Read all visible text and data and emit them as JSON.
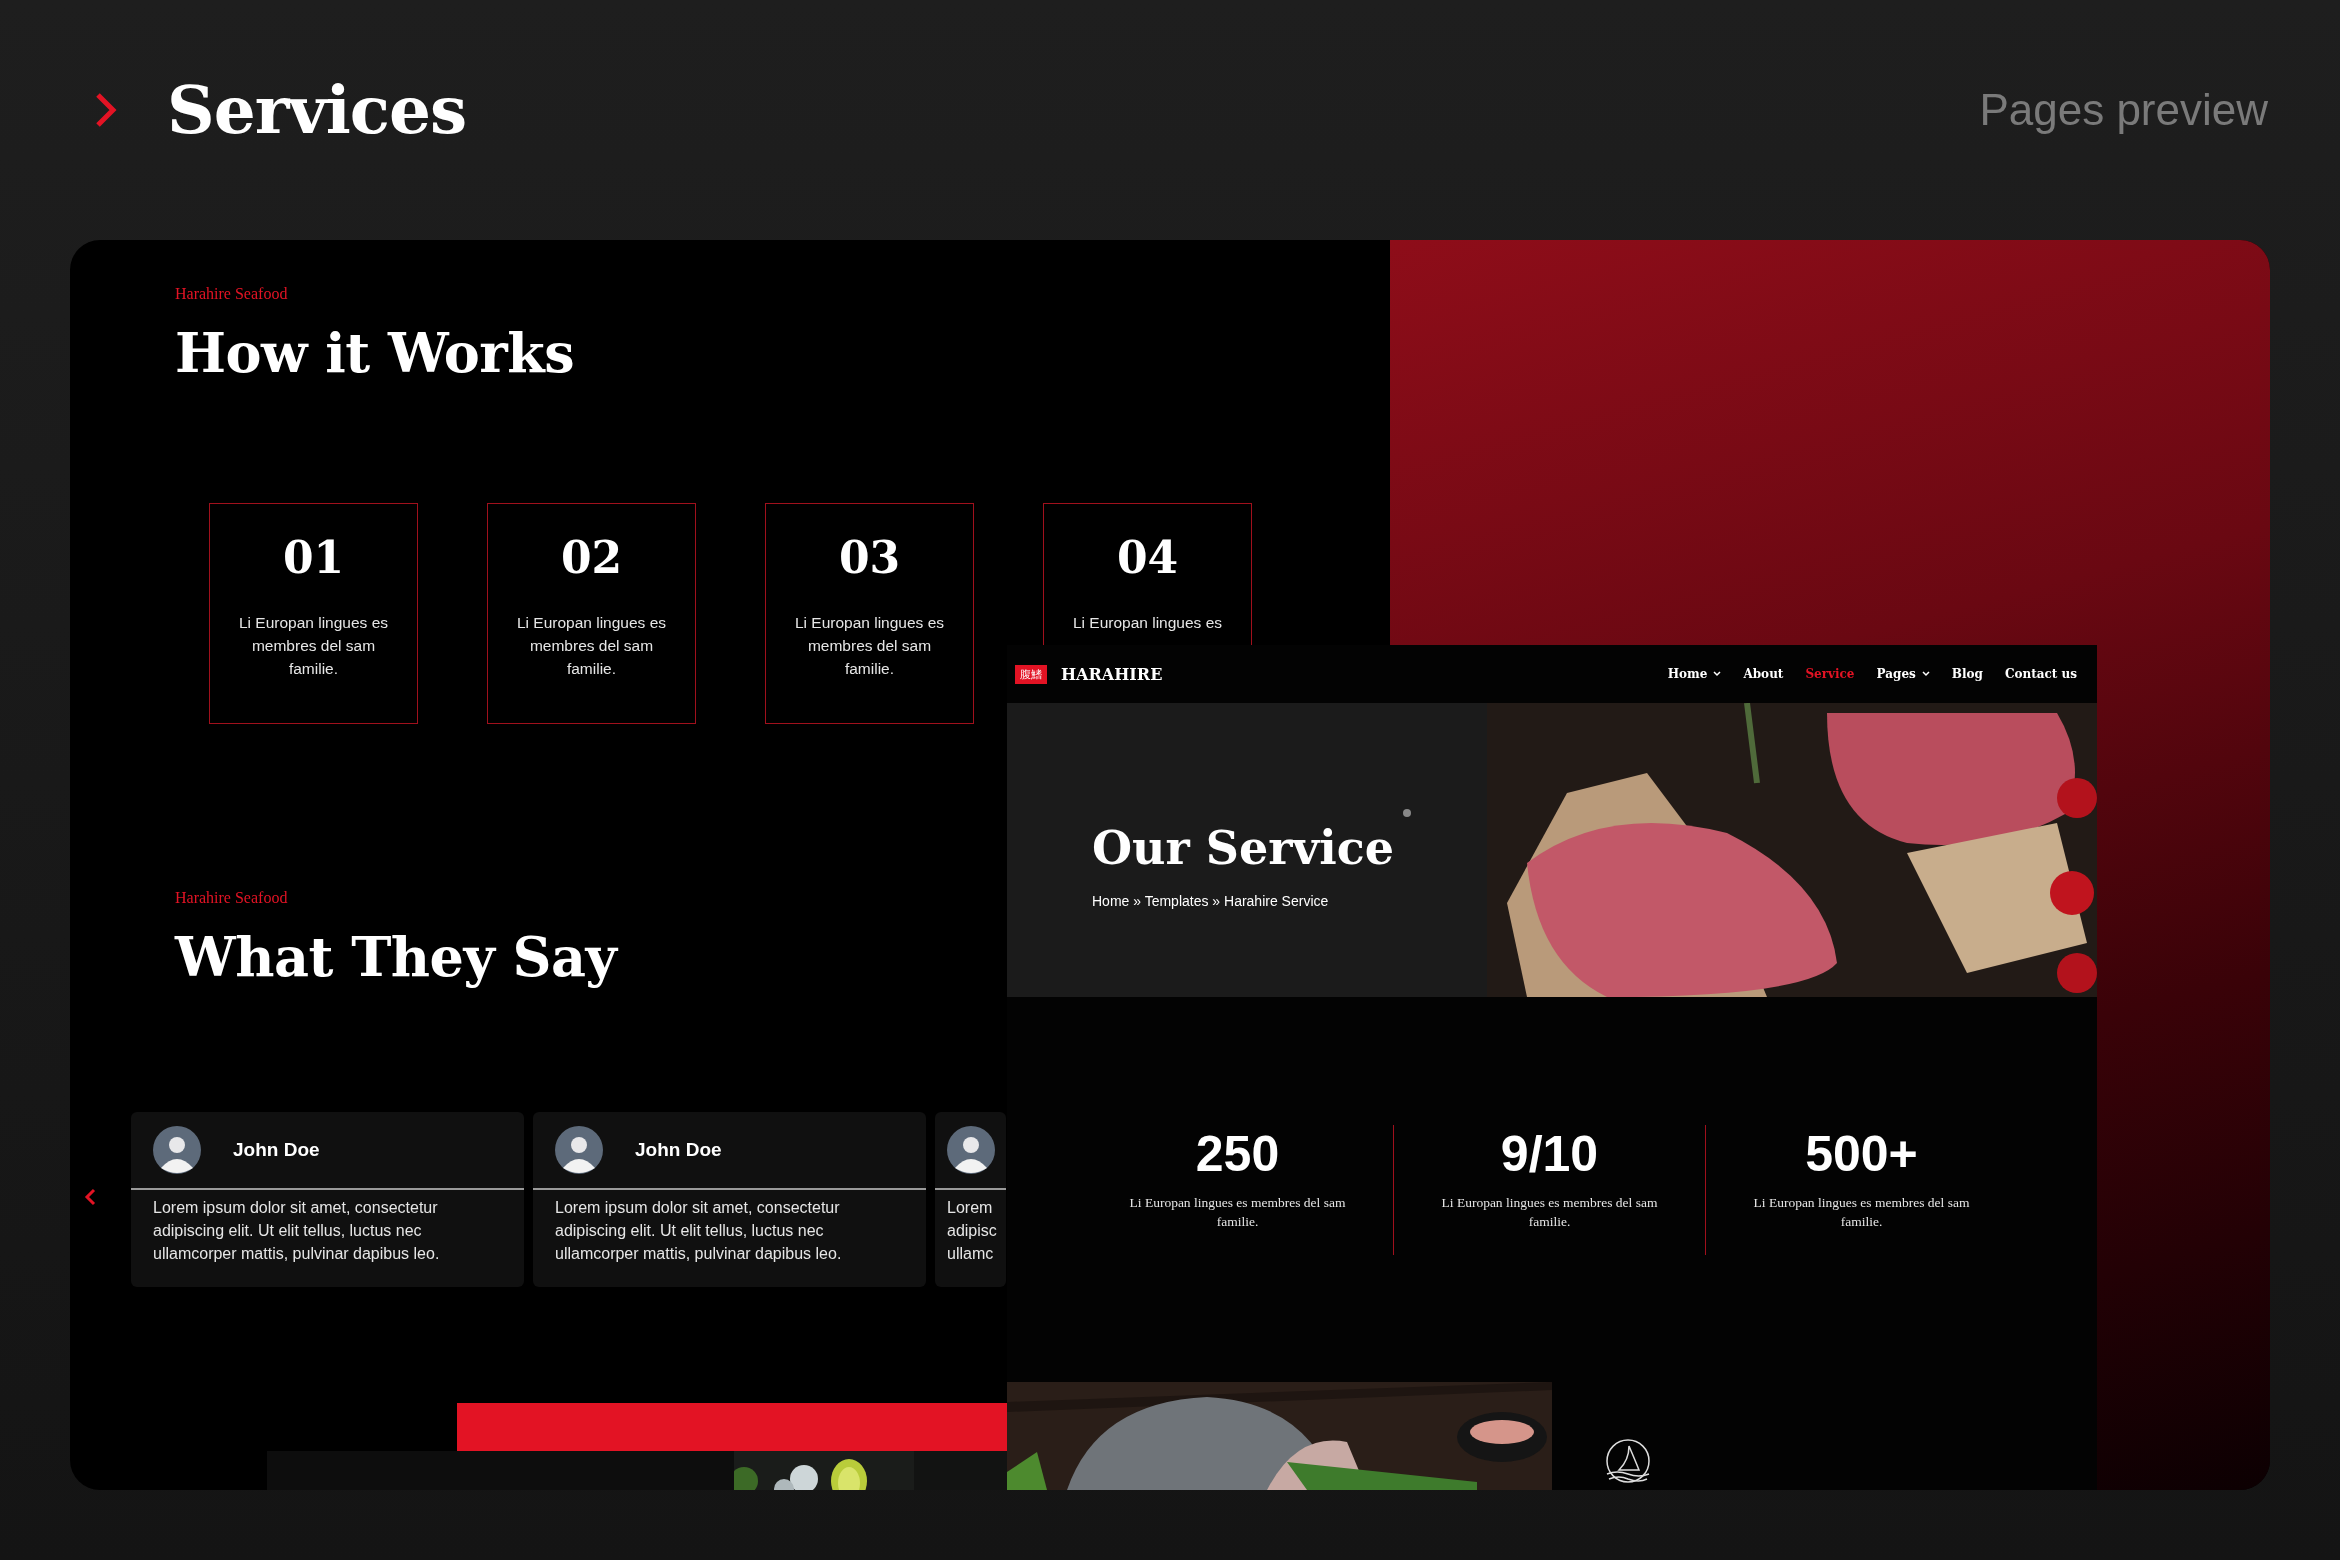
{
  "header": {
    "title": "Services",
    "subtitle": "Pages preview"
  },
  "how_it_works": {
    "eyebrow": "Harahire Seafood",
    "title": "How it Works",
    "steps": [
      {
        "number": "01",
        "text": "Li Europan lingues es membres del sam familie."
      },
      {
        "number": "02",
        "text": "Li Europan lingues es membres del sam familie."
      },
      {
        "number": "03",
        "text": "Li Europan lingues es membres del sam familie."
      },
      {
        "number": "04",
        "text": "Li Europan lingues es"
      }
    ]
  },
  "testimonials": {
    "eyebrow": "Harahire Seafood",
    "title": "What They Say",
    "cards": [
      {
        "name": "John Doe",
        "text": "Lorem ipsum dolor sit amet, consectetur adipiscing elit. Ut elit tellus, luctus nec ullamcorper mattis, pulvinar dapibus leo."
      },
      {
        "name": "John Doe",
        "text": "Lorem ipsum dolor sit amet, consectetur adipiscing elit. Ut elit tellus, luctus nec ullamcorper mattis, pulvinar dapibus leo."
      },
      {
        "text": "Lorem adipisc ullamc"
      }
    ]
  },
  "service_page": {
    "logo_badge": "腹鰭",
    "brand": "HARAHIRE",
    "nav": [
      {
        "label": "Home",
        "dropdown": true,
        "selected": false
      },
      {
        "label": "About",
        "dropdown": false,
        "selected": false
      },
      {
        "label": "Service",
        "dropdown": false,
        "selected": true
      },
      {
        "label": "Pages",
        "dropdown": true,
        "selected": false
      },
      {
        "label": "Blog",
        "dropdown": false,
        "selected": false
      },
      {
        "label": "Contact us",
        "dropdown": false,
        "selected": false
      }
    ],
    "hero": {
      "title": "Our Service",
      "breadcrumb": "Home » Templates » Harahire Service"
    },
    "stats": [
      {
        "value": "250",
        "text": "Li Europan lingues es membres del sam familie."
      },
      {
        "value": "9/10",
        "text": "Li Europan lingues es membres del sam familie."
      },
      {
        "value": "500+",
        "text": "Li Europan lingues es membres del sam familie."
      }
    ]
  }
}
